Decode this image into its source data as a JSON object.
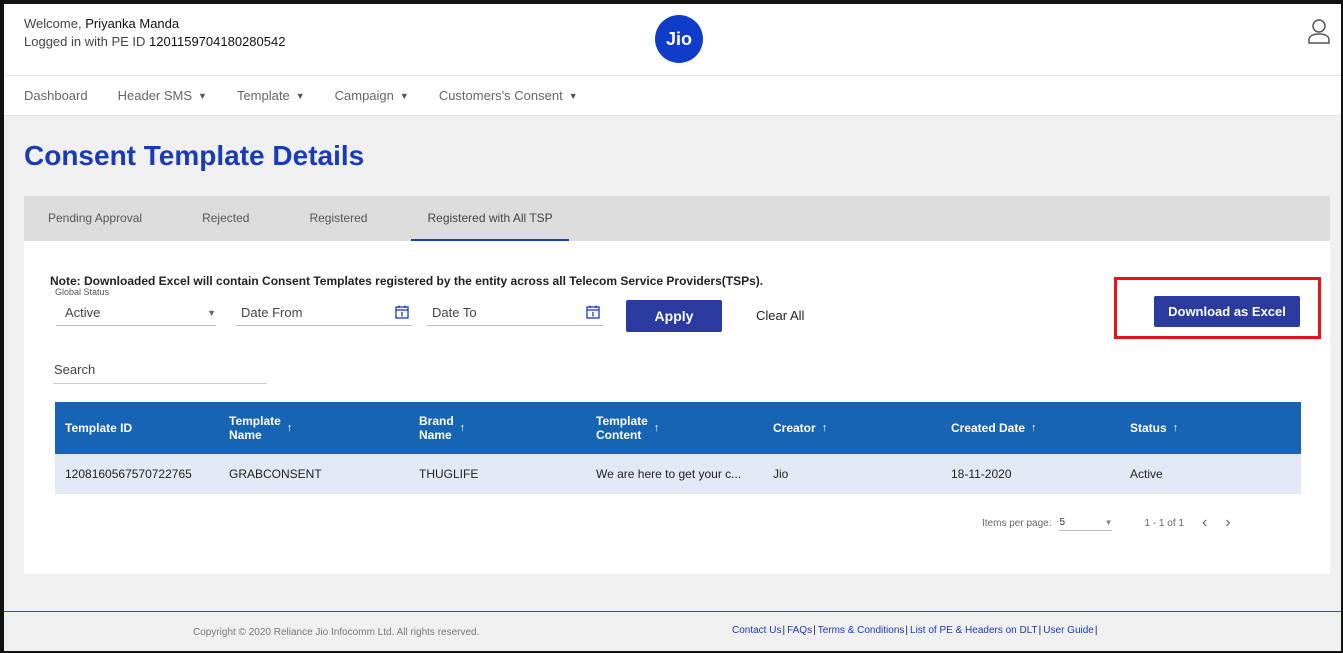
{
  "header": {
    "welcome_prefix": "Welcome,",
    "user_name": "Priyanka Manda",
    "logged_in_prefix": "Logged in with PE ID",
    "pe_id": "1201159704180280542",
    "logo_text": "Jio"
  },
  "nav": {
    "items": [
      {
        "label": "Dashboard",
        "caret": false
      },
      {
        "label": "Header SMS",
        "caret": true
      },
      {
        "label": "Template",
        "caret": true
      },
      {
        "label": "Campaign",
        "caret": true
      },
      {
        "label": "Customers's Consent",
        "caret": true
      }
    ]
  },
  "page": {
    "title": "Consent Template Details"
  },
  "tabs": [
    {
      "label": "Pending Approval",
      "active": false
    },
    {
      "label": "Rejected",
      "active": false
    },
    {
      "label": "Registered",
      "active": false
    },
    {
      "label": "Registered with All TSP",
      "active": true
    }
  ],
  "filters": {
    "note": "Note: Downloaded Excel will contain Consent Templates registered by the entity across all Telecom Service Providers(TSPs).",
    "global_status_label": "Global Status",
    "global_status_value": "Active",
    "date_from_placeholder": "Date From",
    "date_to_placeholder": "Date To",
    "apply_label": "Apply",
    "clear_all_label": "Clear All",
    "download_label": "Download as Excel",
    "search_placeholder": "Search"
  },
  "table": {
    "columns": [
      {
        "label_1": "Template ID",
        "label_2": "",
        "sortable": false
      },
      {
        "label_1": "Template",
        "label_2": "Name",
        "sortable": true
      },
      {
        "label_1": "Brand",
        "label_2": "Name",
        "sortable": true
      },
      {
        "label_1": "Template",
        "label_2": "Content",
        "sortable": true
      },
      {
        "label_1": "Creator",
        "label_2": "",
        "sortable": true
      },
      {
        "label_1": "Created Date",
        "label_2": "",
        "sortable": true
      },
      {
        "label_1": "Status",
        "label_2": "",
        "sortable": true
      }
    ],
    "rows": [
      [
        "1208160567570722765",
        "GRABCONSENT",
        "THUGLIFE",
        "We are here to get your c...",
        "Jio",
        "18-11-2020",
        "Active"
      ]
    ],
    "sort_arrow": "↑"
  },
  "pagination": {
    "items_per_page_label": "Items per page:",
    "items_per_page_value": "5",
    "range": "1 - 1 of 1",
    "prev": "‹",
    "next": "›"
  },
  "footer": {
    "copyright": "Copyright © 2020 Reliance Jio Infocomm Ltd. All rights reserved.",
    "links": [
      "Contact Us",
      "FAQs",
      "Terms & Conditions",
      "List of PE & Headers on DLT",
      "User Guide"
    ]
  },
  "colors": {
    "brand_blue": "#1a3bb3",
    "button_blue": "#2b3a9e",
    "table_header": "#1763b4",
    "highlight_red": "#e8141b"
  }
}
